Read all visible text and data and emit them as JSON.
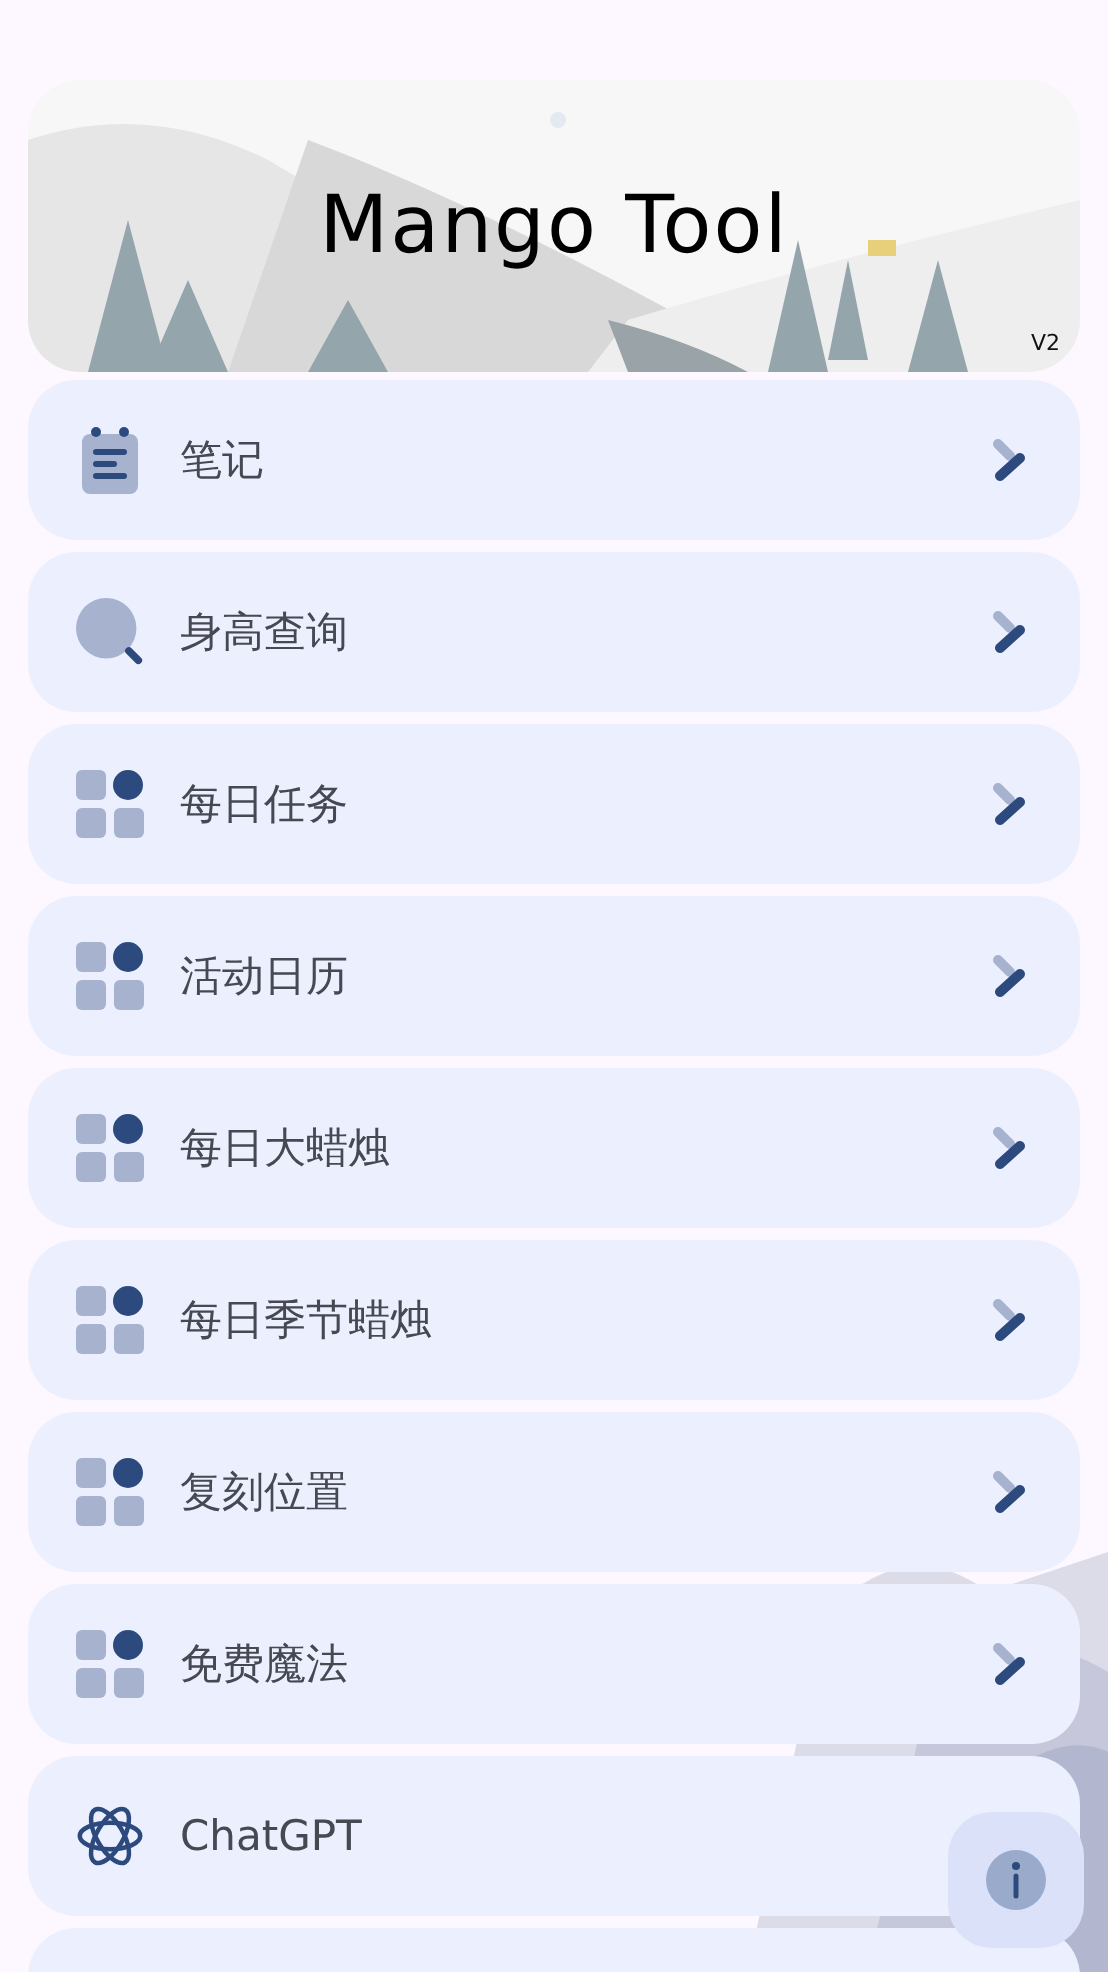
{
  "banner": {
    "title": "Mango Tool",
    "version": "V2"
  },
  "menu": [
    {
      "kind": "notebook",
      "label": "笔记",
      "chevron": true
    },
    {
      "kind": "search",
      "label": "身高查询",
      "chevron": true
    },
    {
      "kind": "grid",
      "label": "每日任务",
      "chevron": true
    },
    {
      "kind": "grid",
      "label": "活动日历",
      "chevron": true
    },
    {
      "kind": "grid",
      "label": "每日大蜡烛",
      "chevron": true
    },
    {
      "kind": "grid",
      "label": "每日季节蜡烛",
      "chevron": true
    },
    {
      "kind": "grid",
      "label": "复刻位置",
      "chevron": true
    },
    {
      "kind": "grid",
      "label": "免费魔法",
      "chevron": true
    },
    {
      "kind": "knot",
      "label": "ChatGPT",
      "chevron": false
    },
    {
      "kind": "empty",
      "chevron": false
    }
  ],
  "fab": {
    "kind": "info"
  }
}
